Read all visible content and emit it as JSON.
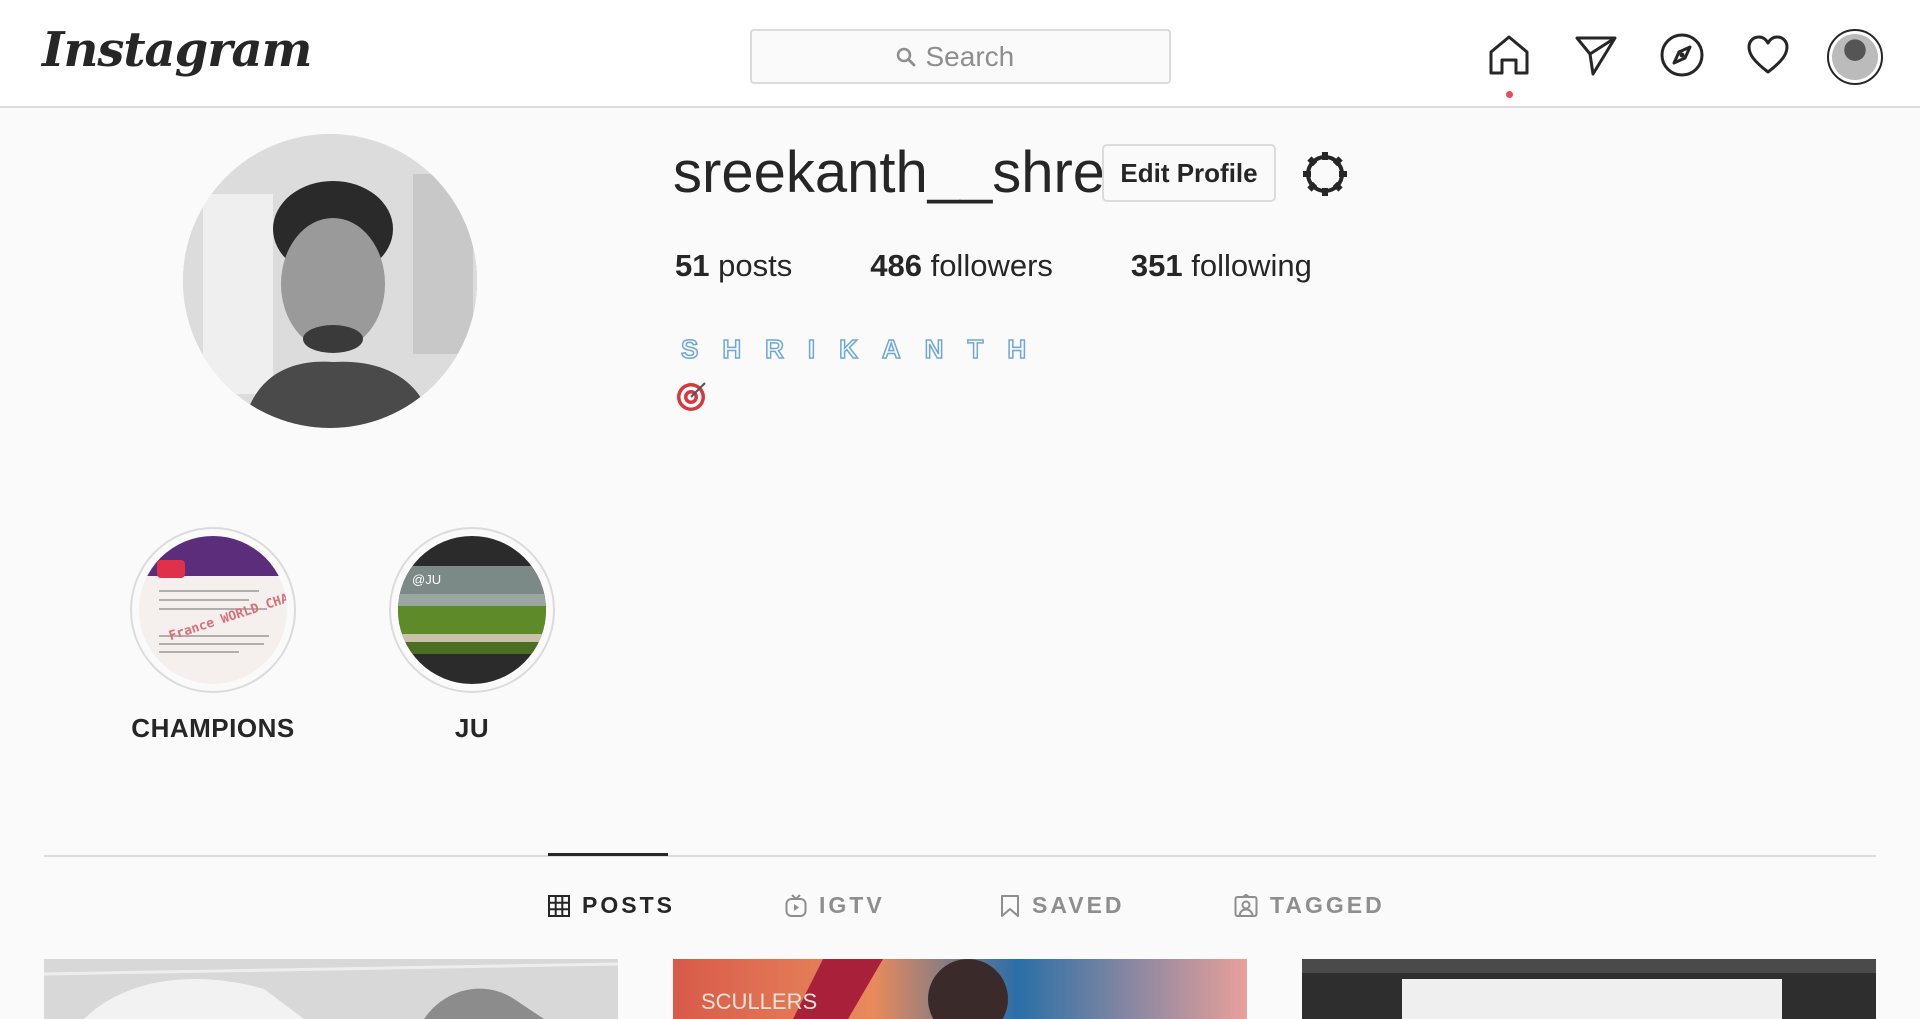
{
  "header": {
    "logo": "Instagram",
    "search_placeholder": "Search",
    "nav_icons": [
      "home-icon",
      "direct-icon",
      "explore-icon",
      "activity-icon",
      "profile-avatar"
    ]
  },
  "profile": {
    "username": "sreekanth__shre",
    "edit_label": "Edit Profile",
    "stats": {
      "posts_count": "51",
      "posts_label": "posts",
      "followers_count": "486",
      "followers_label": "followers",
      "following_count": "351",
      "following_label": "following"
    },
    "bio_name": "SHRIKANTH",
    "bio_emoji": "target-icon"
  },
  "highlights": [
    {
      "label": "CHAMPIONS",
      "thumb_text": "France WORLD CHAMPIONS"
    },
    {
      "label": "JU",
      "thumb_text": "@JU"
    }
  ],
  "tabs": [
    {
      "label": "POSTS",
      "active": true
    },
    {
      "label": "IGTV",
      "active": false
    },
    {
      "label": "SAVED",
      "active": false
    },
    {
      "label": "TAGGED",
      "active": false
    }
  ],
  "posts_visible": [
    "SCULLERS"
  ],
  "colors": {
    "accent_dot": "#ed4956",
    "text": "#262626",
    "muted": "#8e8e8e",
    "border": "#dbdbdb"
  }
}
